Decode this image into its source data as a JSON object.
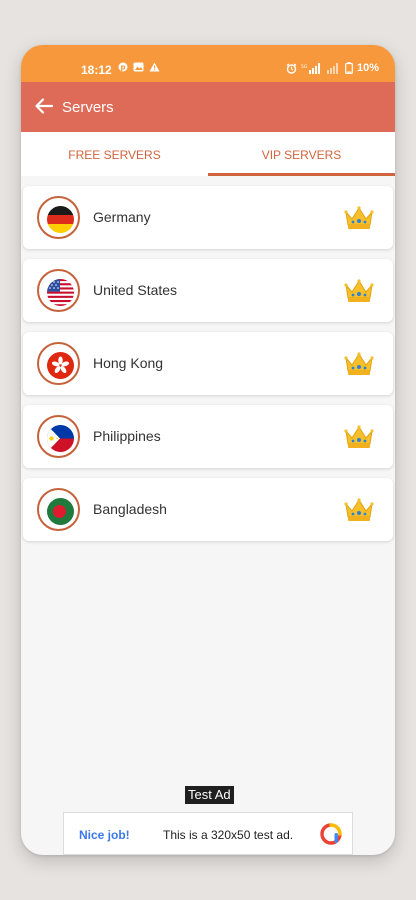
{
  "status_bar": {
    "time": "18:12",
    "battery": "10%",
    "icons_left": [
      "pinterest-icon",
      "image-icon",
      "warning-icon"
    ],
    "icons_right": [
      "alarm-icon",
      "signal-icon",
      "signal-icon",
      "battery-icon"
    ]
  },
  "appbar": {
    "title": "Servers"
  },
  "tabs": [
    {
      "label": "FREE SERVERS",
      "selected": false
    },
    {
      "label": "VIP SERVERS",
      "selected": true
    }
  ],
  "servers": [
    {
      "name": "Germany",
      "flag": "germany-flag-icon",
      "badge": "crown-icon"
    },
    {
      "name": "United States",
      "flag": "usa-flag-icon",
      "badge": "crown-icon"
    },
    {
      "name": "Hong Kong",
      "flag": "hong-kong-flag-icon",
      "badge": "crown-icon"
    },
    {
      "name": "Philippines",
      "flag": "philippines-flag-icon",
      "badge": "crown-icon"
    },
    {
      "name": "Bangladesh",
      "flag": "bangladesh-flag-icon",
      "badge": "crown-icon"
    }
  ],
  "ad": {
    "label": "Test Ad",
    "nice": "Nice job!",
    "text": "This is a 320x50 test ad."
  },
  "colors": {
    "status_bar": "#f6983b",
    "appbar": "#de6a58",
    "accent": "#d0643e",
    "background": "#f6f6f6"
  }
}
